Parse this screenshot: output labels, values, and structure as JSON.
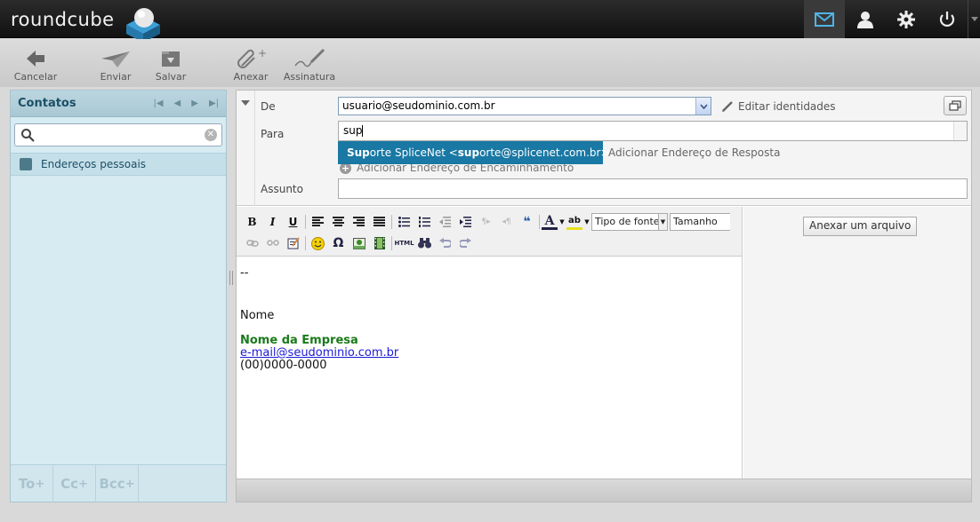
{
  "app": {
    "logo_text": "roundcube"
  },
  "topnav": {
    "items": [
      {
        "name": "mail",
        "icon": "envelope-icon",
        "active": true
      },
      {
        "name": "contacts",
        "icon": "user-icon",
        "active": false
      },
      {
        "name": "settings",
        "icon": "gear-icon",
        "active": false
      },
      {
        "name": "logout",
        "icon": "power-icon",
        "active": false
      }
    ]
  },
  "toolbar": {
    "cancel_label": "Cancelar",
    "send_label": "Enviar",
    "save_label": "Salvar",
    "attach_label": "Anexar",
    "signature_label": "Assinatura"
  },
  "contacts": {
    "title": "Contatos",
    "search": {
      "value": "",
      "placeholder": ""
    },
    "addressbook_label": "Endereços pessoais",
    "footer": {
      "to_label": "To",
      "cc_label": "Cc",
      "bcc_label": "Bcc"
    }
  },
  "compose": {
    "from_label": "De",
    "from_value": "usuario@seudominio.com.br",
    "edit_identities_label": "Editar identidades",
    "to_label": "Para",
    "to_value": "sup",
    "autocomplete": {
      "match_1": "Sup",
      "name_rest": "orte SpliceNet <",
      "match_2": "sup",
      "email_rest": "orte@splicenet.com.br>"
    },
    "add_replyto_label": "Adicionar Endereço de Resposta",
    "add_followup_label": "Adicionar Endereço de Encaminhamento",
    "subject_label": "Assunto",
    "subject_value": "",
    "editor": {
      "font_select": "Tipo de fonte",
      "size_select": "Tamanho",
      "html_label": "HTML",
      "bold": "B",
      "italic": "I",
      "underline": "U",
      "omega": "Ω",
      "body": {
        "separator": "--",
        "name": "Nome",
        "company": "Nome da Empresa",
        "email": "e-mail@seudominio.com.br",
        "phone": "(00)0000-0000"
      }
    },
    "attach_file_label": "Anexar um arquivo"
  },
  "colors": {
    "accent": "#1978a4",
    "topbar": "#1a1a1a",
    "panel": "#d7ebf3",
    "company_text": "#1a7a1a",
    "link": "#1a1ad6"
  }
}
